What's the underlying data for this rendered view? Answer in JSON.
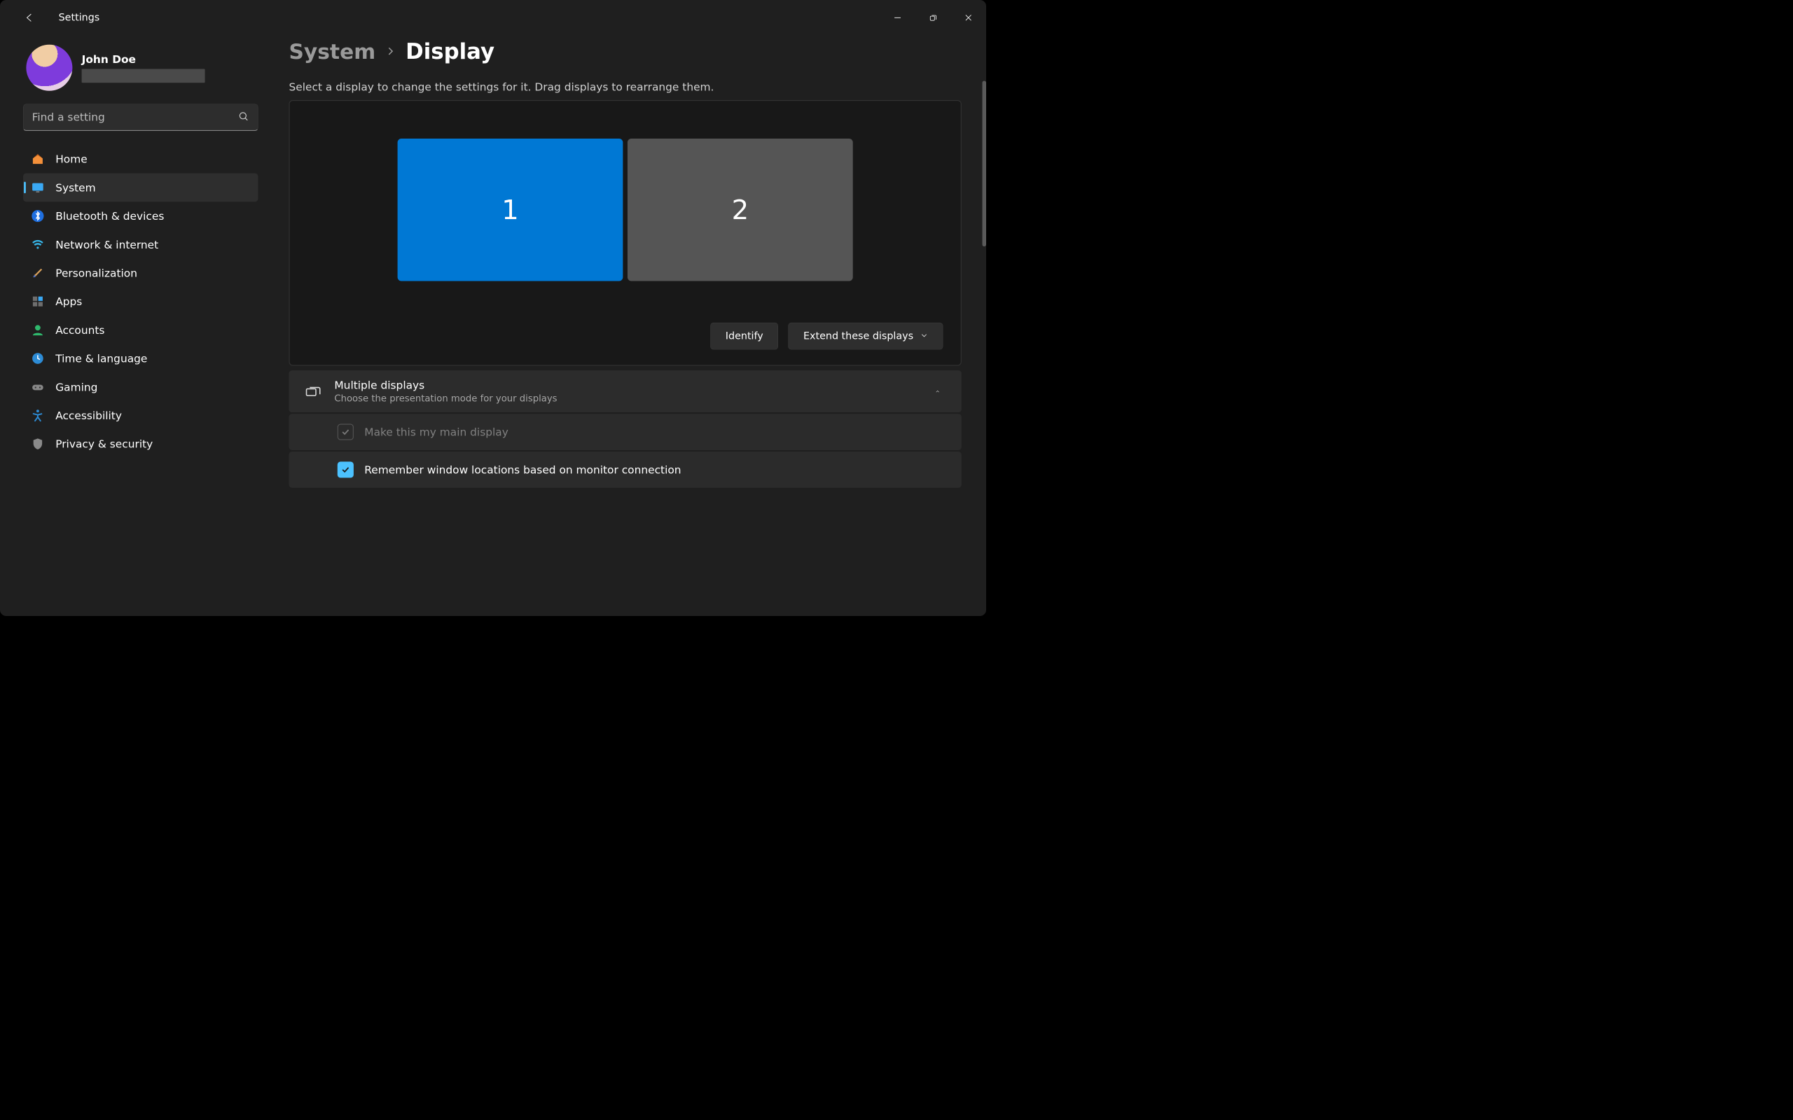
{
  "titlebar": {
    "app_name": "Settings"
  },
  "profile": {
    "name": "John Doe"
  },
  "search": {
    "placeholder": "Find a setting"
  },
  "nav": {
    "items": [
      {
        "label": "Home"
      },
      {
        "label": "System"
      },
      {
        "label": "Bluetooth & devices"
      },
      {
        "label": "Network & internet"
      },
      {
        "label": "Personalization"
      },
      {
        "label": "Apps"
      },
      {
        "label": "Accounts"
      },
      {
        "label": "Time & language"
      },
      {
        "label": "Gaming"
      },
      {
        "label": "Accessibility"
      },
      {
        "label": "Privacy & security"
      }
    ],
    "active_index": 1
  },
  "breadcrumb": {
    "prev": "System",
    "current": "Display"
  },
  "subtitle": "Select a display to change the settings for it. Drag displays to rearrange them.",
  "monitors": [
    {
      "label": "1",
      "selected": true
    },
    {
      "label": "2",
      "selected": false
    }
  ],
  "actions": {
    "identify": "Identify",
    "extend": "Extend these displays"
  },
  "group": {
    "title": "Multiple displays",
    "desc": "Choose the presentation mode for your displays"
  },
  "options": {
    "main_display": "Make this my main display",
    "remember_locations": "Remember window locations based on monitor connection"
  }
}
